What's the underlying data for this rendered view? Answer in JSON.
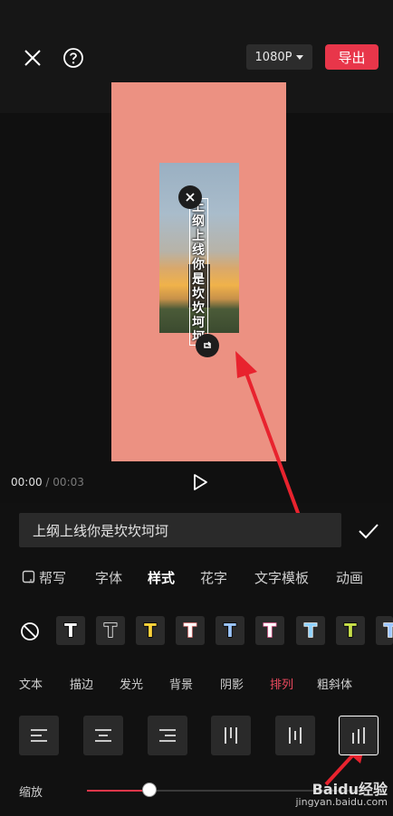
{
  "header": {
    "resolution": "1080P",
    "export_label": "导出"
  },
  "canvas": {
    "overlay_text": "上纲上线你是坎坎坷坷"
  },
  "playback": {
    "current": "00:00",
    "separator": "/",
    "total": "00:03"
  },
  "text_input": {
    "value": "上纲上线你是坎坎坷坷"
  },
  "tabs": [
    {
      "label": "帮写"
    },
    {
      "label": "字体"
    },
    {
      "label": "样式"
    },
    {
      "label": "花字"
    },
    {
      "label": "文字模板"
    },
    {
      "label": "动画"
    }
  ],
  "style_presets": [
    {
      "glyph": "T",
      "fill": "#ffffff",
      "stroke": "#000000"
    },
    {
      "glyph": "T",
      "fill": "#2b2b2b",
      "stroke": "#ffffff"
    },
    {
      "glyph": "T",
      "fill": "#ffd43b",
      "stroke": "#000000"
    },
    {
      "glyph": "T",
      "fill": "#ffffff",
      "stroke": "#ff8a8a"
    },
    {
      "glyph": "T",
      "fill": "#9cc6ff",
      "stroke": "#000000"
    },
    {
      "glyph": "T",
      "fill": "#ffffff",
      "stroke": "#ff6fa8"
    },
    {
      "glyph": "T",
      "fill": "#8fd3ff",
      "stroke": "#ffffff"
    },
    {
      "glyph": "T",
      "fill": "#c8e04a",
      "stroke": "#000000"
    },
    {
      "glyph": "T",
      "fill": "#9cc6ff",
      "stroke": "#ffffff"
    }
  ],
  "subtabs": [
    {
      "label": "文本"
    },
    {
      "label": "描边"
    },
    {
      "label": "发光"
    },
    {
      "label": "背景"
    },
    {
      "label": "阴影"
    },
    {
      "label": "排列"
    },
    {
      "label": "粗斜体"
    }
  ],
  "zoom": {
    "label": "缩放",
    "value_fraction": 0.23
  },
  "watermark": {
    "line1": "Baidu经验",
    "line2": "jingyan.baidu.com"
  },
  "colors": {
    "accent": "#e8364a",
    "canvas_bg": "#ec9182"
  }
}
